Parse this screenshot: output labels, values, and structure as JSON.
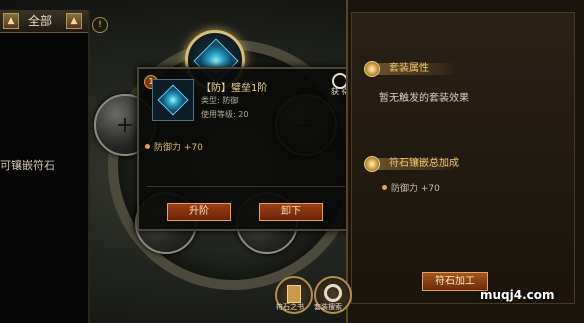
{
  "left_panel": {
    "filter": {
      "label": "全部",
      "prev_icon": "chevron-up-icon",
      "next_icon": "chevron-up-icon"
    },
    "item_text": "可镶嵌符石"
  },
  "center": {
    "info_icon_label": "!"
  },
  "tooltip": {
    "level_badge": "1",
    "name": "【防】璧垒1阶",
    "type_line": "类型: 防御",
    "use_level_line": "使用等级: 20",
    "acquire_label": "获 得",
    "attribute": "防御力 +70",
    "upgrade_button": "升阶",
    "unequip_button": "卸下"
  },
  "right_panel": {
    "set_attr_title": "套装属性",
    "set_attr_text": "暂无触发的套装效果",
    "rune_bonus_title": "符石镶嵌总加成",
    "rune_bonus_attr": "防御力 +70",
    "craft_button": "符石加工"
  },
  "bottom_nav": {
    "rune_box_label": "符石之书",
    "set_search_label": "套装搜索"
  },
  "watermark": "muqj4.com",
  "colors": {
    "accent": "#f1c66c",
    "button": "#9b3f14"
  }
}
